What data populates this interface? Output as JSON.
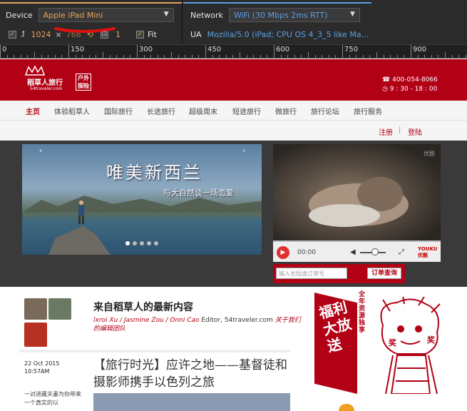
{
  "devtools": {
    "device": {
      "label": "Device",
      "value": "Apple iPad Mini"
    },
    "network": {
      "label": "Network",
      "value": "WiFi (30 Mbps 2ms RTT)"
    },
    "resolution": {
      "width": "1024",
      "times": "×",
      "height": "768"
    },
    "scale": "1",
    "fit_label": "Fit",
    "ua": {
      "label": "UA",
      "value": "Mozilla/5.0 (iPad; CPU OS 4_3_5 like Ma..."
    },
    "ruler": [
      "0",
      "150",
      "300",
      "450",
      "600",
      "750",
      "900"
    ],
    "colors": {
      "orange": "#e8a35a",
      "blue": "#5aa0e8",
      "panel": "#2b2b2b"
    }
  },
  "site": {
    "logo": {
      "name": "稻草人旅行",
      "domain": "54traveler.com",
      "tag": "户外 探险"
    },
    "contact": {
      "phone": "400-054-8066",
      "hours": "9 : 30 - 18 : 00"
    },
    "nav": [
      "主页",
      "体验稻草人",
      "国际旅行",
      "长途旅行",
      "超级周末",
      "短途旅行",
      "微旅行",
      "旅行论坛",
      "旅行服务"
    ],
    "auth": {
      "register": "注册",
      "sep": "|",
      "login": "登陆"
    },
    "banner": {
      "headline": "唯美新西兰",
      "subline": "与大自然谈一场恋爱",
      "prev": "‹",
      "next": "›"
    },
    "video": {
      "watermark": "优酷",
      "time": "00:00",
      "brand": "YOUKU 优酷"
    },
    "order": {
      "placeholder": "输入长短途订单号",
      "button": "订单查询"
    },
    "latest": {
      "title": "来自稻草人的最新内容",
      "editors": "lxroi Xu / Jasmine Zou / Onni Cao",
      "editors_suffix": "Editor, 54traveler.com",
      "editors_note": "关于我们",
      "editors_note2": "的编辑团队"
    },
    "article": {
      "date": "22 Oct 2015",
      "time": "10:57AM",
      "title": "【旅行时光】应许之地——基督徒和摄影师携手以色列之旅",
      "snippet": "一对进藏夫妻为你带来一个真实的以"
    },
    "promo": {
      "big": "福利大放送",
      "small": "全年资源独享",
      "mark": "奖"
    },
    "brand_color": "#b20015"
  }
}
